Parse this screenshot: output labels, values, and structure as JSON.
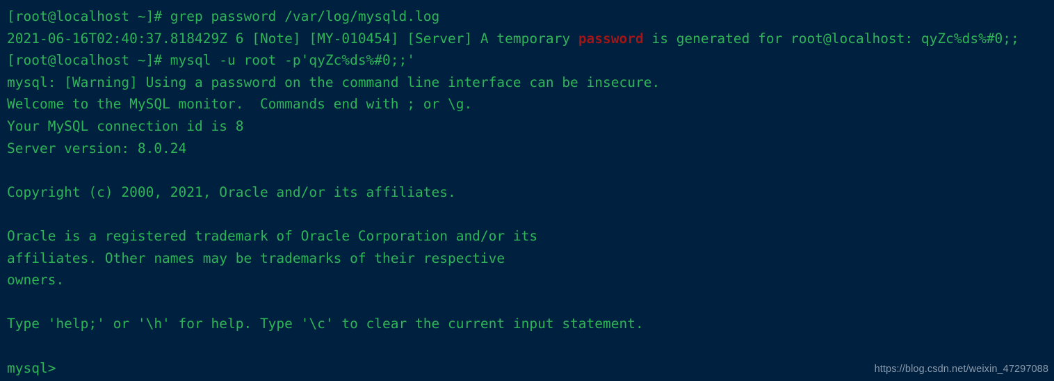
{
  "terminal": {
    "background_color": "#00203f",
    "text_color": "#2fb457",
    "highlight_color": "#a31515",
    "prompt_user_host": "[root@localhost ~]#",
    "lines": [
      {
        "id": "line-grep-command",
        "segments": [
          {
            "text": "[root@localhost ~]# grep password /var/log/mysqld.log",
            "style": "green"
          }
        ]
      },
      {
        "id": "line-grep-result",
        "segments": [
          {
            "text": "2021-06-16T02:40:37.818429Z 6 [Note] [MY-010454] [Server] A temporary ",
            "style": "green"
          },
          {
            "text": "password",
            "style": "red"
          },
          {
            "text": " is generated for root@localhost: qyZc%ds%#0;;",
            "style": "green"
          }
        ]
      },
      {
        "id": "line-mysql-command",
        "segments": [
          {
            "text": "[root@localhost ~]# mysql -u root -p'qyZc%ds%#0;;'",
            "style": "green"
          }
        ]
      },
      {
        "id": "line-warning",
        "segments": [
          {
            "text": "mysql: [Warning] Using a password on the command line interface can be insecure.",
            "style": "green"
          }
        ]
      },
      {
        "id": "line-welcome",
        "segments": [
          {
            "text": "Welcome to the MySQL monitor.  Commands end with ; or \\g.",
            "style": "green"
          }
        ]
      },
      {
        "id": "line-connection-id",
        "segments": [
          {
            "text": "Your MySQL connection id is 8",
            "style": "green"
          }
        ]
      },
      {
        "id": "line-server-version",
        "segments": [
          {
            "text": "Server version: 8.0.24",
            "style": "green"
          }
        ]
      },
      {
        "id": "line-blank-1",
        "segments": [
          {
            "text": " ",
            "style": "green"
          }
        ]
      },
      {
        "id": "line-copyright",
        "segments": [
          {
            "text": "Copyright (c) 2000, 2021, Oracle and/or its affiliates.",
            "style": "green"
          }
        ]
      },
      {
        "id": "line-blank-2",
        "segments": [
          {
            "text": " ",
            "style": "green"
          }
        ]
      },
      {
        "id": "line-trademark-1",
        "segments": [
          {
            "text": "Oracle is a registered trademark of Oracle Corporation and/or its",
            "style": "green"
          }
        ]
      },
      {
        "id": "line-trademark-2",
        "segments": [
          {
            "text": "affiliates. Other names may be trademarks of their respective",
            "style": "green"
          }
        ]
      },
      {
        "id": "line-trademark-3",
        "segments": [
          {
            "text": "owners.",
            "style": "green"
          }
        ]
      },
      {
        "id": "line-blank-3",
        "segments": [
          {
            "text": " ",
            "style": "green"
          }
        ]
      },
      {
        "id": "line-help-hint",
        "segments": [
          {
            "text": "Type 'help;' or '\\h' for help. Type '\\c' to clear the current input statement.",
            "style": "green"
          }
        ]
      },
      {
        "id": "line-blank-4",
        "segments": [
          {
            "text": " ",
            "style": "green"
          }
        ]
      },
      {
        "id": "line-mysql-prompt",
        "segments": [
          {
            "text": "mysql>",
            "style": "green"
          }
        ]
      }
    ]
  },
  "watermark": {
    "text": "https://blog.csdn.net/weixin_47297088",
    "color": "#8b9aab"
  }
}
